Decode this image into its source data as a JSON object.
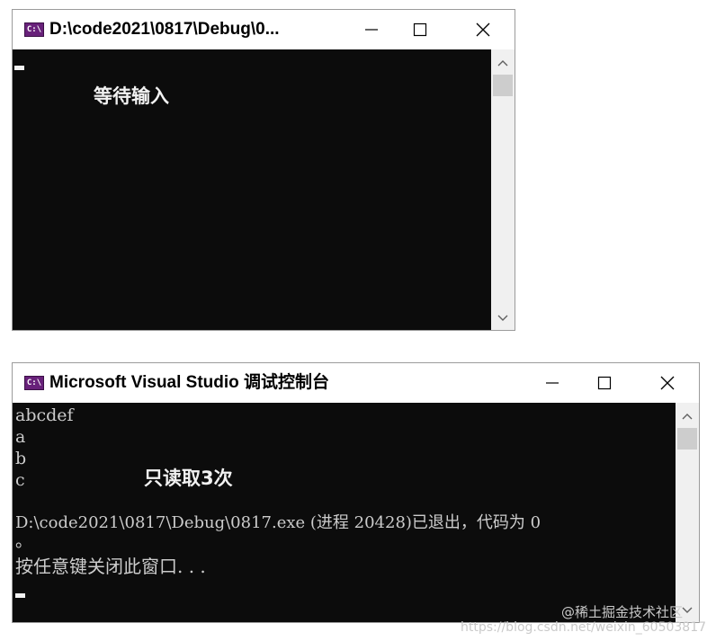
{
  "window1": {
    "title": "D:\\code2021\\0817\\Debug\\0...",
    "icon": "C:\\",
    "annotation": "等待输入"
  },
  "window2": {
    "title": "Microsoft Visual Studio 调试控制台",
    "icon": "C:\\",
    "annotation": "只读取3次",
    "lines": [
      "abcdef",
      "a",
      "b",
      "c",
      "",
      "D:\\code2021\\0817\\Debug\\0817.exe (进程 20428)已退出，代码为 0",
      "。",
      "按任意键关闭此窗口. . ."
    ]
  },
  "watermark": {
    "line1": "@稀土掘金技术社区",
    "line2": "https://blog.csdn.net/weixin_60503817"
  },
  "colors": {
    "console_bg": "#0c0c0c",
    "console_text": "#cccccc",
    "titlebar_bg": "#ffffff",
    "scrollbar_bg": "#f0f0f0",
    "icon_bg": "#68217a"
  }
}
